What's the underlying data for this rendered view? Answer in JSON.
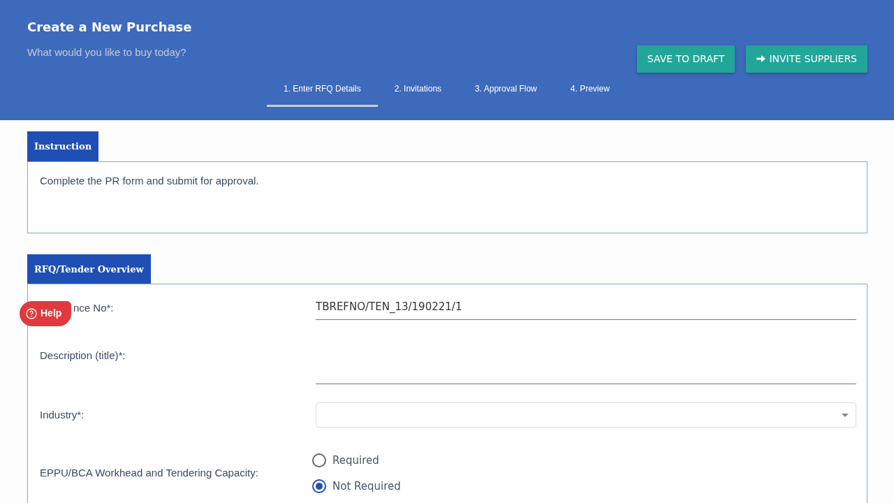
{
  "header": {
    "title": "Create a New Purchase",
    "subtitle": "What would you like to buy today?"
  },
  "actions": [
    {
      "label": "SAVE TO DRAFT",
      "kind": "plain"
    },
    {
      "label": "INVITE SUPPLIERS",
      "kind": "arrow"
    }
  ],
  "steps": [
    {
      "label": "1. Enter RFQ Details",
      "selected": true
    },
    {
      "label": "2. Invitations",
      "selected": false
    },
    {
      "label": "3. Approval Flow",
      "selected": false
    },
    {
      "label": "4. Preview",
      "selected": false
    }
  ],
  "instruction": {
    "heading": "Instruction",
    "text": "Complete the PR form and submit for approval."
  },
  "overview": {
    "heading": "RFQ/Tender Overview",
    "fields": [
      {
        "kind": "text",
        "label": "nce No*:",
        "value": "TBREFNO/TEN_13/190221/1"
      },
      {
        "kind": "text",
        "label": "Description (title)*:"
      },
      {
        "kind": "select",
        "label": "Industry*:"
      },
      {
        "kind": "radio",
        "label": "EPPU/BCA Workhead and Tendering Capacity:",
        "options": [
          {
            "label": "Required",
            "selected": false
          },
          {
            "label": "Not Required",
            "selected": true
          }
        ]
      }
    ]
  },
  "help": {
    "label": "Help"
  }
}
